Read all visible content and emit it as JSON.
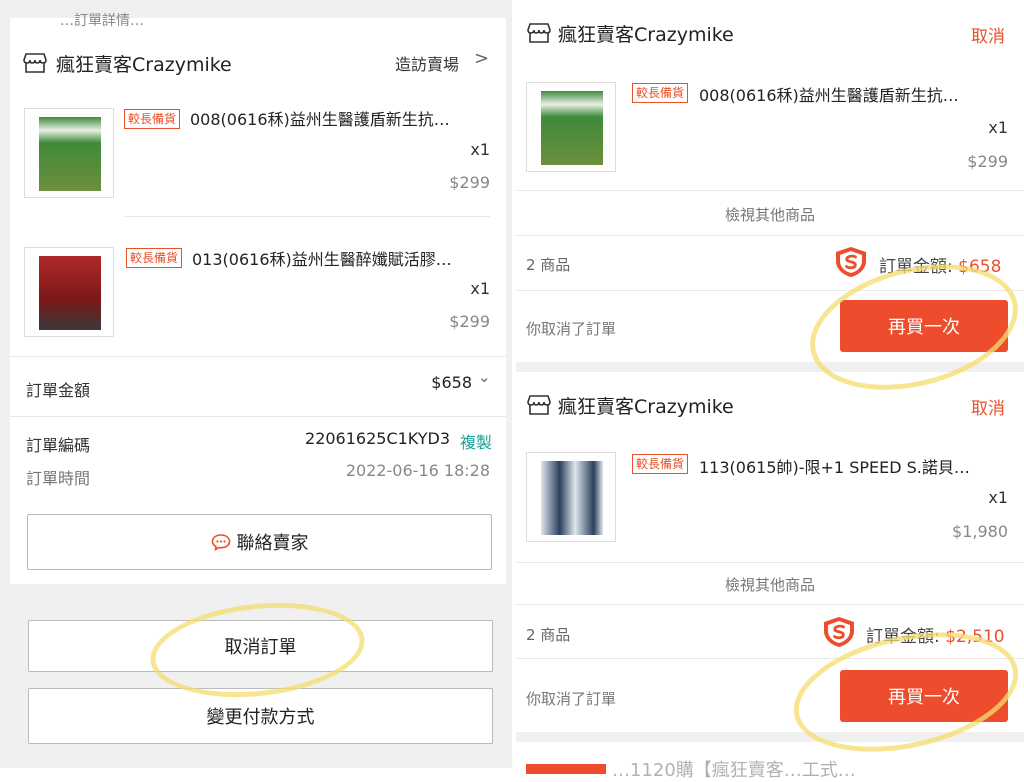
{
  "left": {
    "top_remnant": "…訂單詳情…",
    "store": {
      "name": "瘋狂賣客Crazymike",
      "visit_label": "造訪賣場",
      "chevron": ">"
    },
    "products": [
      {
        "tag": "較長備貨",
        "name": "008(0616秝)益州生醫護盾新生抗…",
        "qty": "x1",
        "price": "$299",
        "thumb_color": "#3f8a3a"
      },
      {
        "tag": "較長備貨",
        "name": "013(0616秝)益州生醫醉孅賦活膠…",
        "qty": "x1",
        "price": "$299",
        "thumb_color": "#8a1d1d"
      }
    ],
    "order_total_label": "訂單金額",
    "order_total_value": "$658",
    "order_total_chevron": "⌄",
    "order_no_label": "訂單編碼",
    "order_no_value": "22061625C1KYD3",
    "copy_label": "複製",
    "order_time_label": "訂單時間",
    "order_time_value": "2022-06-16 18:28",
    "contact_label": "聯絡賣家",
    "cancel_order_label": "取消訂單",
    "change_payment_label": "變更付款方式"
  },
  "right": {
    "orders": [
      {
        "store_name": "瘋狂賣客Crazymike",
        "status": "取消",
        "tag": "較長備貨",
        "product_name": "008(0616秝)益州生醫護盾新生抗…",
        "qty": "x1",
        "price": "$299",
        "view_more": "檢視其他商品",
        "items_count": "2 商品",
        "total_label": "訂單金額: ",
        "total_amount": "$658",
        "cancelled_note": "你取消了訂單",
        "buy_again": "再買一次"
      },
      {
        "store_name": "瘋狂賣客Crazymike",
        "status": "取消",
        "tag": "較長備貨",
        "product_name": "113(0615帥)-限+1 SPEED S.諾貝…",
        "qty": "x1",
        "price": "$1,980",
        "view_more": "檢視其他商品",
        "items_count": "2 商品",
        "total_label": "訂單金額: ",
        "total_amount": "$2,510",
        "cancelled_note": "你取消了訂單",
        "buy_again": "再買一次"
      }
    ],
    "bottom_partial_text": "…1120購【瘋狂賣客…工式…"
  },
  "colors": {
    "accent": "#ee4d2d",
    "copy_link": "#1aa09a",
    "highlight": "#f5dc6e",
    "background": "#f0f0f0"
  },
  "icons": {
    "store": "store-icon",
    "chevron_right": "chevron-right-icon",
    "chevron_down": "chevron-down-icon",
    "chat": "chat-bubble-icon",
    "shield": "shopee-guarantee-shield-icon"
  }
}
